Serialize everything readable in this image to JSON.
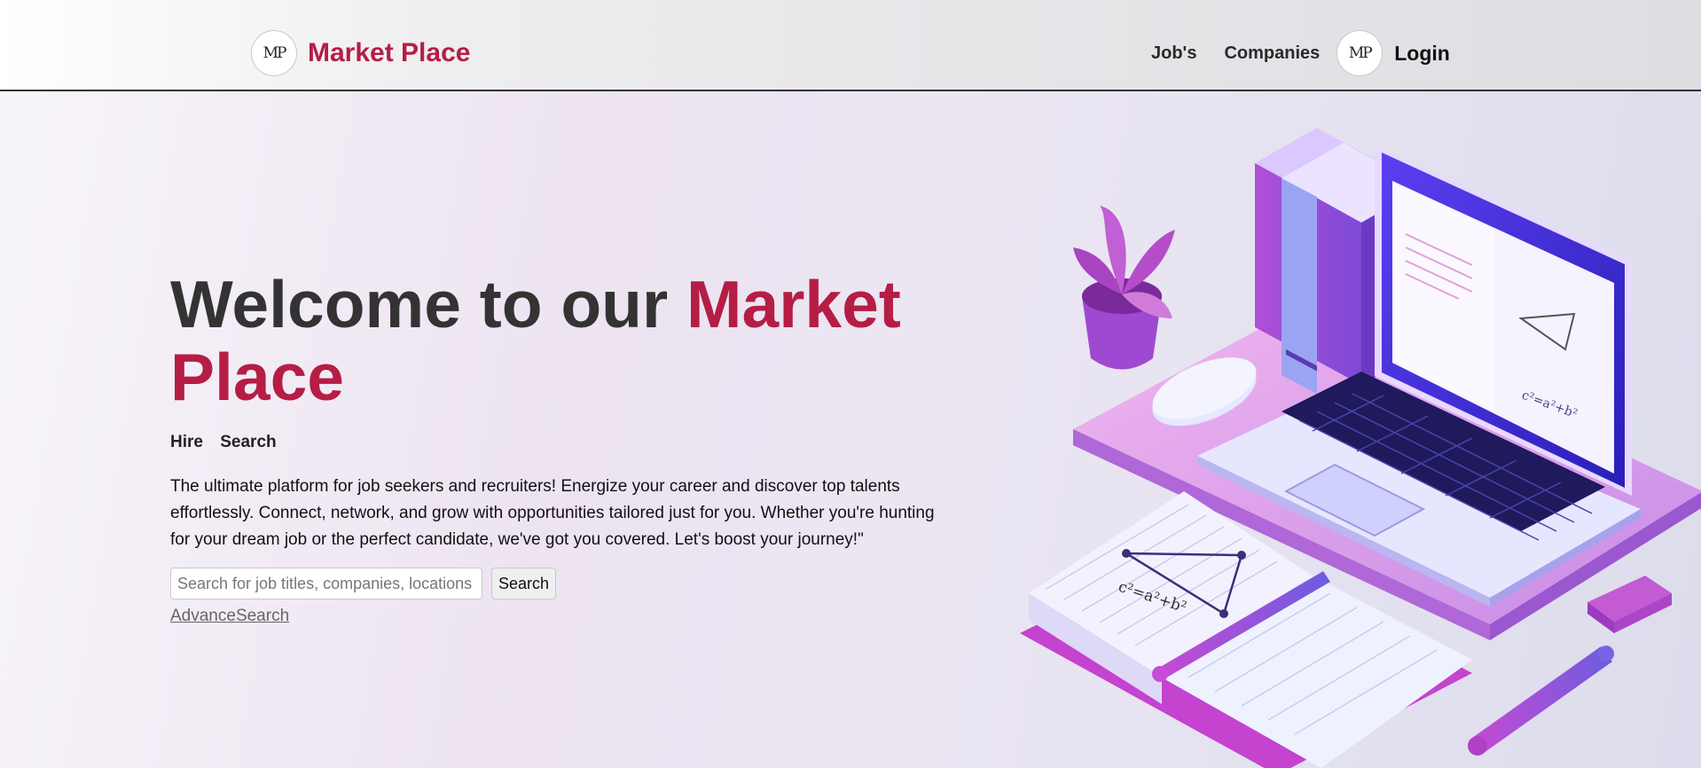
{
  "navbar": {
    "logo_text": "MP",
    "brand_name": "Market Place",
    "links": {
      "jobs": "Job's",
      "companies": "Companies"
    },
    "user_avatar_text": "MP",
    "login_label": "Login"
  },
  "hero": {
    "headline_part1": "Welcome to our ",
    "headline_accent": "Market Place",
    "tags": [
      "Hire",
      "Search"
    ],
    "description": "The ultimate platform for job seekers and recruiters! Energize your career and discover top talents effortlessly. Connect, network, and grow with opportunities tailored just for you. Whether you're hunting for your dream job or the perfect candidate, we've got you covered. Let's boost your journey!\"",
    "search": {
      "placeholder": "Search for job titles, companies, locations",
      "value": "",
      "button_label": "Search"
    },
    "advance_search_label": "AdvanceSearch"
  },
  "illustration": {
    "name": "laptop-books-plant-illustration",
    "formula": "c²=a²+b²"
  },
  "colors": {
    "brand": "#b51d45",
    "heading": "#333333",
    "accent_purple": "#a24fd6",
    "keyboard": "#1e1a5c"
  }
}
